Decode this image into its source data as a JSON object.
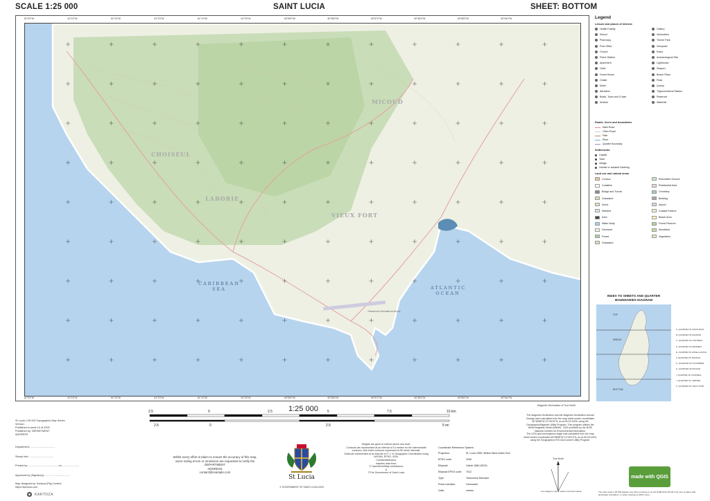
{
  "header": {
    "scale": "SCALE 1:25 000",
    "title": "SAINT LUCIA",
    "sheet": "SHEET: BOTTOM"
  },
  "map": {
    "top_ticks": [
      "61°5'0\"W",
      "61°4'0\"W",
      "61°3'0\"W",
      "61°2'0\"W",
      "61°1'0\"W",
      "61°0'0\"W",
      "60°59'0\"W",
      "60°58'0\"W",
      "60°57'0\"W",
      "60°56'0\"W",
      "60°55'0\"W",
      "60°54'0\"W"
    ],
    "bottom_ticks": [
      "61°5'0\"W",
      "61°4'0\"W",
      "61°3'0\"W",
      "61°2'0\"W",
      "61°1'0\"W",
      "61°0'0\"W",
      "60°59'0\"W",
      "60°58'0\"W",
      "60°57'0\"W",
      "60°56'0\"W",
      "60°55'0\"W",
      "60°54'0\"W"
    ],
    "places": [
      "MICOUD",
      "CHOISEUL",
      "LABORIE",
      "VIEUX FORT"
    ],
    "seas": [
      "CARIBBEAN SEA",
      "ATLANTIC OCEAN"
    ],
    "airport": "Hewanorra International Airport",
    "colors": {
      "sea": "#b6d4ee",
      "land": "#eef0e4",
      "forest": "#c9ddb8",
      "coast": "#ffffff"
    }
  },
  "legend": {
    "title": "Legend",
    "poi_heading": "Leisure and places of interest",
    "poi_left": [
      "Health Facility",
      "School",
      "Pharmacy",
      "Post Office",
      "Church",
      "Police Station",
      "Apartment",
      "Hotel",
      "Guest House",
      "Chalet",
      "Motel",
      "Attraction",
      "Boats, Tours and Cruise",
      "Artwork"
    ],
    "poi_right": [
      "Gallery",
      "Information",
      "Theme Park",
      "Viewpoint",
      "Ruins",
      "Archaeological Site",
      "Lighthouse",
      "Seaport",
      "Beach Place",
      "Peak",
      "Quarry",
      "Trigonometrical Station",
      "Reservoir",
      "Waterfall"
    ],
    "roads_heading": "Roads, rivers and boundaries",
    "roads": [
      "Main Road",
      "Other Road",
      "Path",
      "River",
      "Quarter Boundary"
    ],
    "settlements_heading": "Settlements",
    "settlements": [
      "Capital",
      "Town",
      "Village",
      "Hamlet or Isolated Dwelling"
    ],
    "landuse_heading": "Land use and natural areas",
    "landuse_left": [
      {
        "label": "Contour",
        "color": "#e7c9a0"
      },
      {
        "label": "Coastline",
        "color": "#ffffff"
      },
      {
        "label": "Bridge and Tunnel",
        "color": "#888888"
      },
      {
        "label": "Grassland",
        "color": "#cfe3b3"
      },
      {
        "label": "Scrub",
        "color": "#d8e6c0"
      },
      {
        "label": "Wetland",
        "color": "#d7e6ee"
      },
      {
        "label": "Dam",
        "color": "#444444"
      },
      {
        "label": "Water Body",
        "color": "#aad3f0"
      },
      {
        "label": "Farmland",
        "color": "#f0f2e2"
      },
      {
        "label": "Forest",
        "color": "#add19e"
      },
      {
        "label": "Grassland",
        "color": "#cfe3b3"
      }
    ],
    "landuse_right": [
      {
        "label": "Recreation Ground",
        "color": "#c8e6c8"
      },
      {
        "label": "Residential Area",
        "color": "#e0dfdf"
      },
      {
        "label": "Cemetery",
        "color": "#aacbaf"
      },
      {
        "label": "Building",
        "color": "#a8a8a8"
      },
      {
        "label": "Airport",
        "color": "#dad7e6"
      },
      {
        "label": "Coastal Feature",
        "color": "#f3efd6"
      },
      {
        "label": "Beach Area",
        "color": "#fff1ba"
      },
      {
        "label": "Forest Reserve",
        "color": "#b5d29b"
      },
      {
        "label": "Woodland",
        "color": "#c6dfa7"
      },
      {
        "label": "Vegetation",
        "color": "#dbe9c6"
      }
    ]
  },
  "index": {
    "title": "INDEX TO SHEETS AND QUARTER BOUNDARIES DIAGRAM",
    "labels": [
      "TOP",
      "MIDDLE",
      "BOTTOM"
    ],
    "quarters": [
      "A. QUARTER OF GROS-ISLET",
      "B. QUARTER OF DAUPHIN",
      "C. QUARTER OF CASTRIES",
      "D. QUARTER OF DENNERY",
      "E. QUARTER OF ANSE-LA-RAYE",
      "F. QUARTER OF PRASLIN",
      "G. QUARTER OF SOUFRIERE",
      "H. QUARTER OF MICOUD",
      "I. QUARTER OF CHOISEUL",
      "J. QUARTER OF LABORIE",
      "K. QUARTER OF VIEUX FORT"
    ]
  },
  "scalebar": {
    "ratio": "1:25 000",
    "km_labels": [
      "2.5",
      "0",
      "2.5",
      "5",
      "7.5",
      "10 km"
    ],
    "mi_labels": [
      "2.5",
      "0",
      "2.5",
      "5 mi"
    ]
  },
  "info_left": [
    "St Lucia 1:25 000 Topographic Map Series",
    "Version:",
    "Published in week 10 of 2025",
    "Published by: DEPARTMENT",
    "ADDRESS"
  ],
  "signatures": [
    "Department: .................................",
    "Stamp Info: .................................",
    "Printed by: ........................................ on .......................",
    "Approved by (Signatory): .................................."
  ],
  "designer": [
    "Map designed by: Kartoza (Pty) Limited",
    "https://kartoza.com"
  ],
  "kartoza": "KARTOZA",
  "disclaimer": [
    "Whilst every effort is taken to ensure the accuracy of this map,",
    "users noting errors or omissions are requested to notify the",
    "DEPARTMENT",
    "ADDRESS",
    "contact@example.com"
  ],
  "coat": {
    "name": "St Lucia",
    "copyright": "© GOVERNMENT OF SAINT LUCIA 2025"
  },
  "notes": [
    "Heights are given in metres above sea level.",
    "Contours are represented at an interval of 10 metres for the intermediate contours, with index contours expressed at 50 metre intervals.",
    "Graticule represented at an interval of 0° 1' in Geographic Coordinates using WGS84, EPSG: 4326.",
    "Credits/Attribution:",
    "Includes data from:",
    "© OpenStreetMap contributors",
    "&",
    "©The Government of Saint Lucia"
  ],
  "crs": {
    "title": "Coordinate Reference System",
    "rows": [
      [
        "Projection:",
        "St. Lucia 1955 / British West Indies Grid"
      ],
      [
        "EPSG code:",
        "2006"
      ],
      [
        "Ellipsoid:",
        "Clarke 1880 (RGS)"
      ],
      [
        "Ellipsoid EPSG code:",
        "7012"
      ],
      [
        "Type:",
        "Transverse Mercator"
      ],
      [
        "Prime meridian:",
        "Greenwich"
      ],
      [
        "Units:",
        "metres"
      ]
    ]
  },
  "declination": {
    "caption": "Magnetic Declination of True North",
    "text": [
      "The Magnetic Declination and the Magnetic Declination Annual Change were calculated from the map sheet centre coordinates 60°58'58\"W 13°46'19\"N, as at 09-03-2025, using the Geographic/Magnetic Utility Program. This program utilises the World Magnetic Model (WMM) - 2020 provided by the NOEI National Centers for Environmental Information.",
      "The UTM grid convergence angle was calculated from the map sheet centre coordinates 60°58'58\"W 13°46'19\"N, as at 09-03-2025, using the Geographic/UTM GeoConvert Utility Program."
    ],
    "true_north": "True North",
    "note": "Line diagram only to assist numerical values."
  },
  "qgis": "made with QGIS",
  "print_note": "The ratio scale 1:25 000 applies only when printing on an A0 (1189.00 by 84.00 mm) size of paper with landscape orientation, or when viewing at 100% zoom."
}
